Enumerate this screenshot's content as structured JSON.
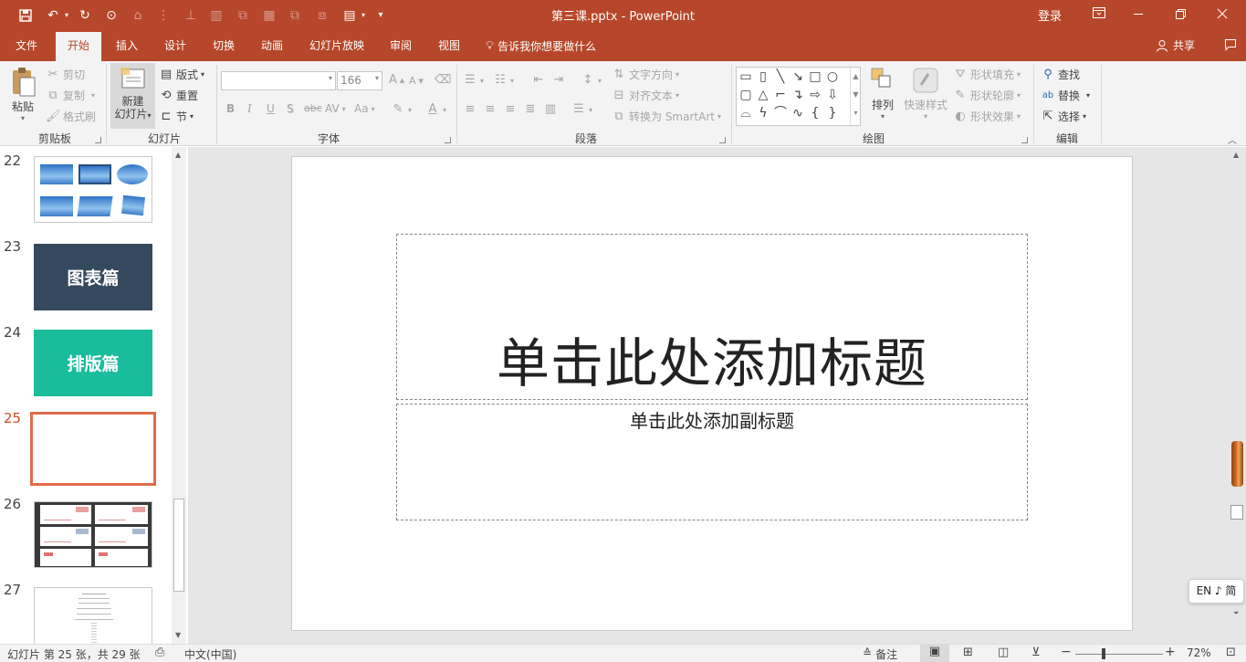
{
  "window": {
    "title": "第三课.pptx  -  PowerPoint",
    "login": "登录"
  },
  "tabs": [
    "文件",
    "开始",
    "插入",
    "设计",
    "切换",
    "动画",
    "幻灯片放映",
    "审阅",
    "视图"
  ],
  "tell_me": "告诉我你想要做什么",
  "share": "共享",
  "ribbon": {
    "clipboard": {
      "paste": "粘贴",
      "cut": "剪切",
      "copy": "复制",
      "format_painter": "格式刷",
      "label": "剪贴板"
    },
    "slides": {
      "new_slide_1": "新建",
      "new_slide_2": "幻灯片",
      "layout": "版式",
      "reset": "重置",
      "section": "节",
      "label": "幻灯片"
    },
    "font": {
      "font_size": "166",
      "bold": "B",
      "italic": "I",
      "underline": "U",
      "shadow": "S",
      "strike": "abc",
      "spacing": "AV",
      "case": "Aa",
      "grow": "A",
      "shrink": "A",
      "label": "字体"
    },
    "paragraph": {
      "text_direction": "文字方向",
      "align_text": "对齐文本",
      "smartart": "转换为 SmartArt",
      "label": "段落"
    },
    "drawing": {
      "arrange": "排列",
      "quick_styles": "快速样式",
      "shape_fill": "形状填充",
      "shape_outline": "形状轮廓",
      "shape_effects": "形状效果",
      "label": "绘图"
    },
    "editing": {
      "find": "查找",
      "replace": "替换",
      "select": "选择",
      "label": "编辑"
    }
  },
  "slides": [
    {
      "num": "22",
      "text": ""
    },
    {
      "num": "23",
      "text": "图表篇"
    },
    {
      "num": "24",
      "text": "排版篇"
    },
    {
      "num": "25",
      "text": ""
    },
    {
      "num": "26",
      "text": ""
    },
    {
      "num": "27",
      "text": ""
    }
  ],
  "slide": {
    "title_placeholder": "单击此处添加标题",
    "subtitle_placeholder": "单击此处添加副标题"
  },
  "ime": {
    "text": "EN ♪ 简"
  },
  "status": {
    "slide_info": "幻灯片 第 25 张，共 29 张",
    "language": "中文(中国)",
    "notes": "备注",
    "zoom": "72%"
  },
  "colors": {
    "accent": "#b7472a",
    "slide23": "#34495e",
    "slide24": "#1abc9c",
    "selected": "#e06b4a"
  }
}
